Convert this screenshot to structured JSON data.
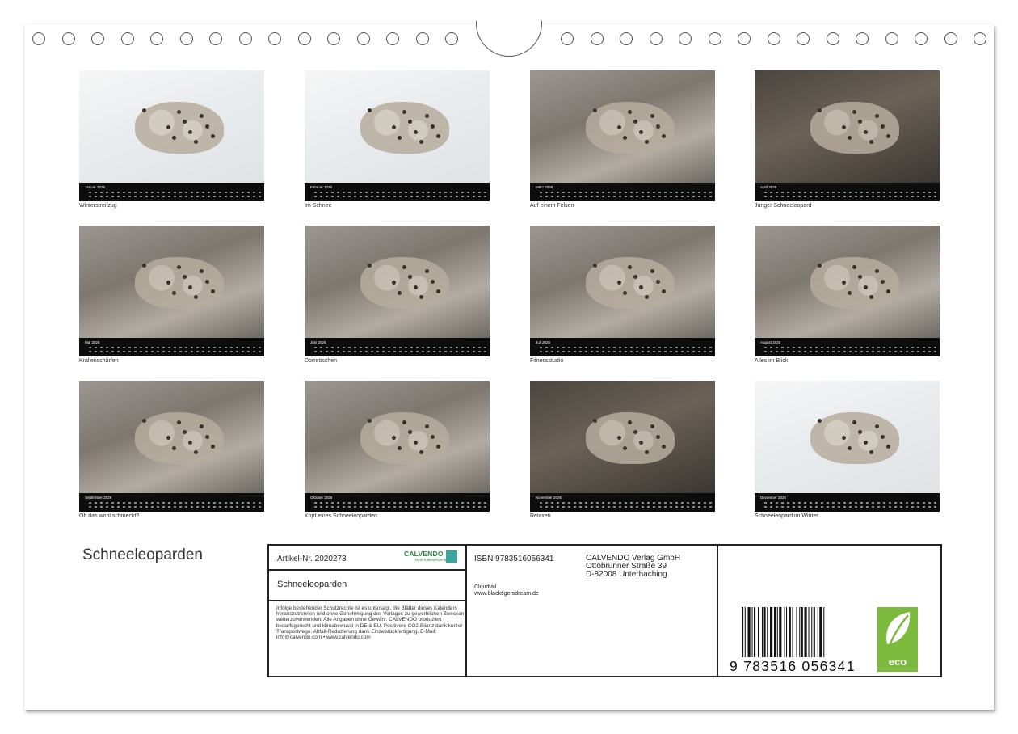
{
  "calendar_title": "Schneeleoparden",
  "months": [
    {
      "month": "Januar 2026",
      "caption": "Winterstreifzug",
      "scene": "snow"
    },
    {
      "month": "Februar 2026",
      "caption": "Im Schnee",
      "scene": "snow"
    },
    {
      "month": "März 2026",
      "caption": "Auf einem Felsen",
      "scene": "rock"
    },
    {
      "month": "April 2026",
      "caption": "Junger Schneeleopard",
      "scene": "dark"
    },
    {
      "month": "Mai 2026",
      "caption": "Krallenschärfen",
      "scene": "rock"
    },
    {
      "month": "Juni 2026",
      "caption": "Dornröschen",
      "scene": "rock"
    },
    {
      "month": "Juli 2026",
      "caption": "Fitnessstudio",
      "scene": "rock"
    },
    {
      "month": "August 2026",
      "caption": "Alles im Blick",
      "scene": "rock"
    },
    {
      "month": "September 2026",
      "caption": "Ob das wohl schmeckt?",
      "scene": "rock"
    },
    {
      "month": "Oktober 2026",
      "caption": "Kopf eines Schneeleoparden",
      "scene": "rock"
    },
    {
      "month": "November 2026",
      "caption": "Relaxen",
      "scene": "dark"
    },
    {
      "month": "Dezember 2026",
      "caption": "Schneeleopard im Winter",
      "scene": "snow"
    }
  ],
  "info": {
    "article": "Artikel-Nr. 2020273",
    "logo": "CALVENDO",
    "logo_sub": "Dein Kalenderverlag",
    "product_title": "Schneeleoparden",
    "legal": "Infolge bestehender Schutzrechte ist es untersagt, die Blätter dieses Kalenders herauszutrennen und ohne Genehmigung des Verlages zu gewerblichen Zwecken weiterzuverwenden. Alle Angaben ohne Gewähr. CALVENDO produziert bedarfsgerecht und klimabewusst in DE & EU. Positivere CO2-Bilanz dank kurzer Transportwege. Abfall-Reduzierung dank Einzelstückfertigung. E-Mail: info@calvendo.com • www.calvendo.com",
    "isbn": "ISBN 9783516056341",
    "publisher_line1": "CALVENDO Verlag GmbH",
    "publisher_line2": "Ottobrunner Straße 39",
    "publisher_line3": "D-82008 Unterhaching",
    "author": "Cloudtail",
    "author_url": "www.blacktigersdream.de",
    "barcode_number": "9 783516 056341",
    "eco_label": "eco"
  }
}
